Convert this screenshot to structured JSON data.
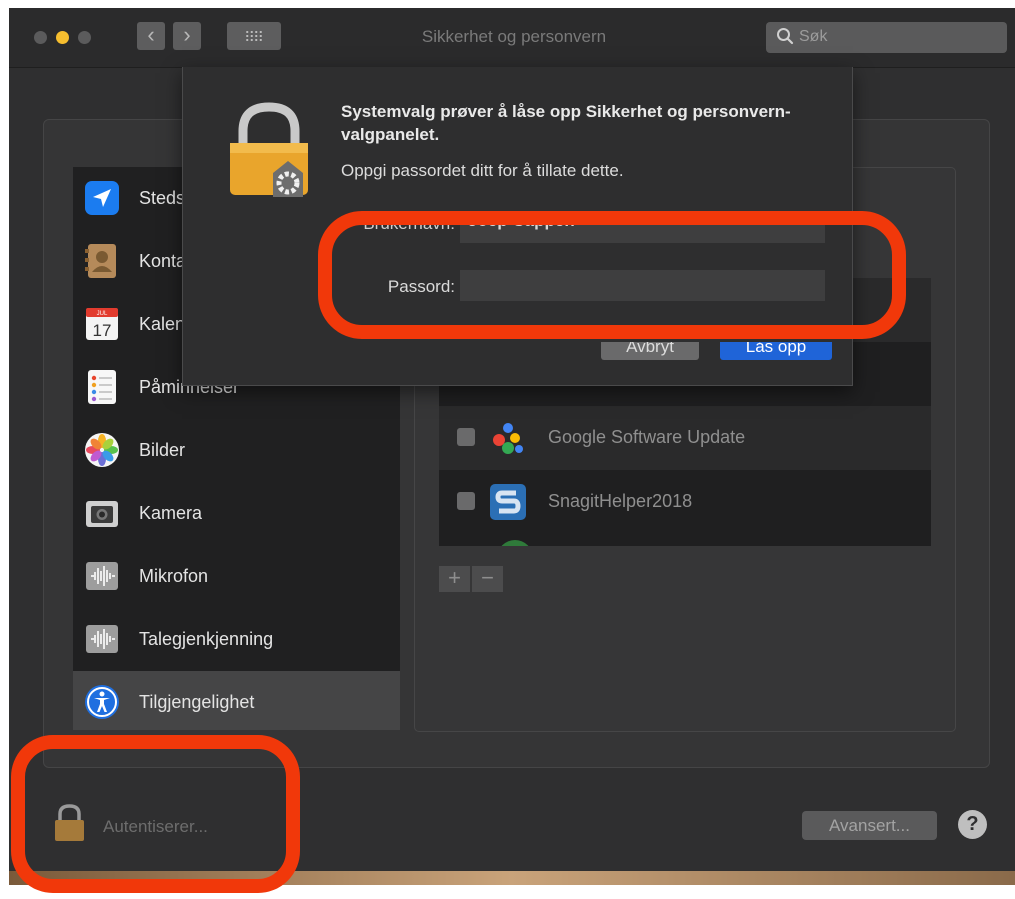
{
  "window": {
    "title": "Sikkerhet og personvern",
    "search_placeholder": "Søk"
  },
  "sidebar": {
    "items": [
      {
        "label": "Stedstjenester",
        "icon": "location-arrow-icon"
      },
      {
        "label": "Kontakter",
        "icon": "contacts-book-icon"
      },
      {
        "label": "Kalender",
        "icon": "calendar-icon"
      },
      {
        "label": "Påminnelser",
        "icon": "reminders-list-icon"
      },
      {
        "label": "Bilder",
        "icon": "photos-flower-icon"
      },
      {
        "label": "Kamera",
        "icon": "camera-icon"
      },
      {
        "label": "Mikrofon",
        "icon": "microphone-waveform-icon"
      },
      {
        "label": "Talegjenkjenning",
        "icon": "speech-waveform-icon"
      },
      {
        "label": "Tilgjengelighet",
        "icon": "accessibility-person-icon",
        "selected": true
      }
    ],
    "calendar_day": "17",
    "calendar_month": "JUL"
  },
  "app_list": {
    "rows": [
      {
        "label": "Google Software Update",
        "icon": "google-update-icon",
        "checked": false
      },
      {
        "label": "SnagitHelper2018",
        "icon": "snagit-s-icon",
        "checked": false
      }
    ],
    "add_label": "+",
    "remove_label": "−"
  },
  "footer": {
    "lock_status": "Autentiserer...",
    "advanced_button": "Avansert...",
    "help_button": "?"
  },
  "auth_sheet": {
    "title": "Systemvalg prøver å låse opp Sikkerhet og personvern-valgpanelet.",
    "message": "Oppgi passordet ditt for å tillate dette.",
    "username_label": "Brukernavn:",
    "username_value": "Joep Cappen",
    "password_label": "Passord:",
    "password_value": "",
    "cancel_button": "Avbryt",
    "unlock_button": "Lås opp"
  },
  "colors": {
    "highlight": "#f1380a",
    "accent_blue": "#1f64d8",
    "lock_gold": "#e9a52c"
  }
}
